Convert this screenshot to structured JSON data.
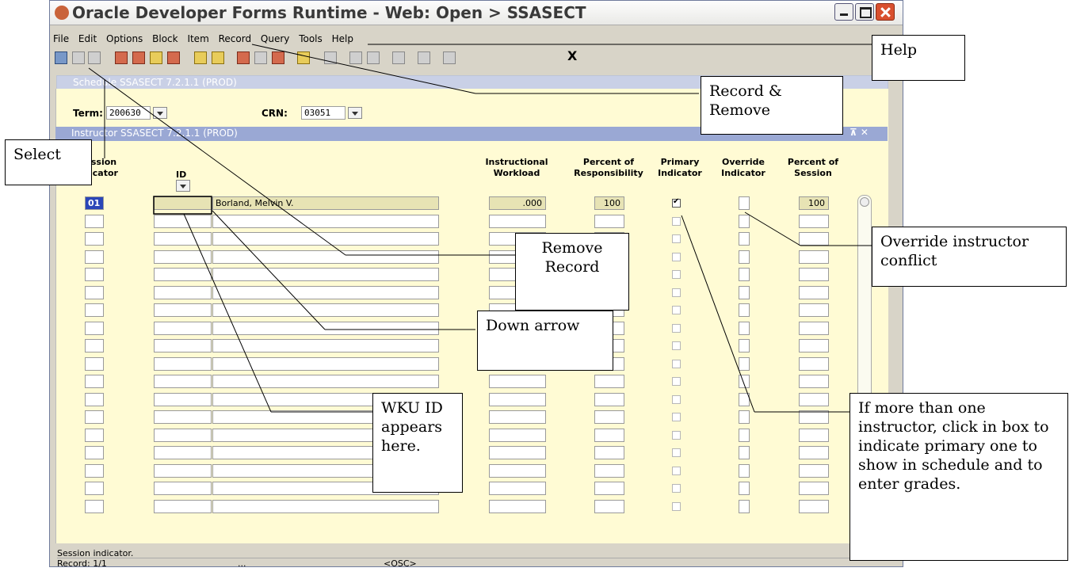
{
  "window": {
    "title": "Oracle Developer Forms Runtime - Web:  Open > SSASECT"
  },
  "menu": [
    "File",
    "Edit",
    "Options",
    "Block",
    "Item",
    "Record",
    "Query",
    "Tools",
    "Help"
  ],
  "toolbar": {
    "exit_label": "X"
  },
  "schedule": {
    "title": "Schedule  SSASECT  7.2.1.1  (PROD)",
    "term_label": "Term:",
    "term_value": "200630",
    "crn_label": "CRN:",
    "crn_value": "03051"
  },
  "instructor": {
    "title": "Instructor  SSASECT  7.2.1.1  (PROD)"
  },
  "columns": {
    "session_line1": "ssion",
    "session_line2": "icator",
    "id": "ID",
    "workload_line1": "Instructional",
    "workload_line2": "Workload",
    "responsibility_line1": "Percent of",
    "responsibility_line2": "Responsibility",
    "primary_line1": "Primary",
    "primary_line2": "Indicator",
    "override_line1": "Override",
    "override_line2": "Indicator",
    "percent_session_line1": "Percent of",
    "percent_session_line2": "Session"
  },
  "first_row": {
    "session": "01",
    "id": "",
    "name": "Borland, Melvin V.",
    "workload": ".000",
    "responsibility": "100",
    "primary_checked": true,
    "percent_session": "100"
  },
  "status": {
    "message": "Session indicator.",
    "record": "Record: 1/1",
    "dots": "...",
    "osc": "<OSC>"
  },
  "annotations": {
    "help": "Help",
    "record_remove": "Record & Remove",
    "select": "Select",
    "override": "Override instructor conflict",
    "remove_record": "Remove Record",
    "down_arrow": "Down arrow",
    "wku_id": "WKU ID appears here.",
    "primary_note": "If more than one instructor, click in box to indicate primary one to show in schedule and to enter grades."
  }
}
